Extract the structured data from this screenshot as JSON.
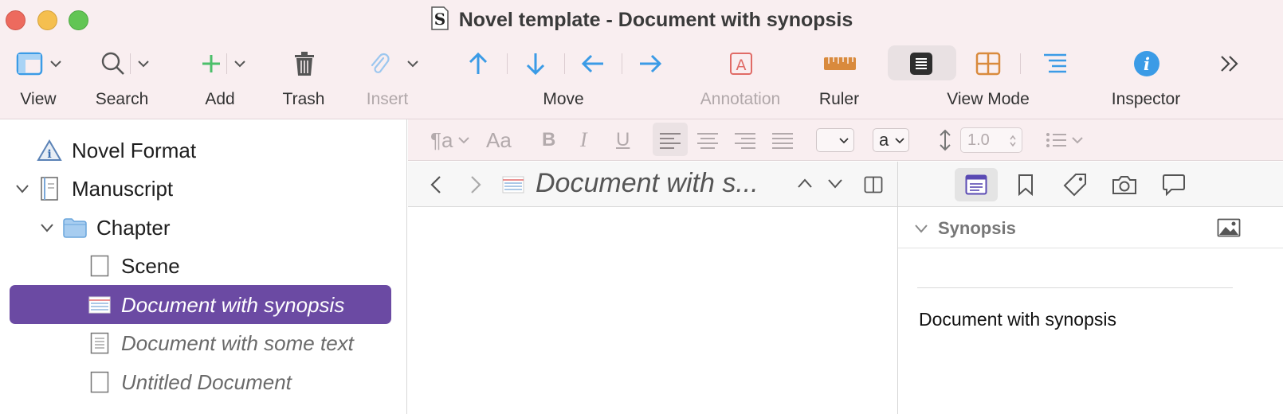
{
  "window": {
    "title": "Novel template - Document with synopsis"
  },
  "toolbar": {
    "view_label": "View",
    "search_label": "Search",
    "add_label": "Add",
    "trash_label": "Trash",
    "insert_label": "Insert",
    "move_label": "Move",
    "annotation_label": "Annotation",
    "ruler_label": "Ruler",
    "viewmode_label": "View Mode",
    "inspector_label": "Inspector"
  },
  "binder": {
    "items": [
      {
        "label": "Novel Format",
        "icon": "info-triangle-icon"
      },
      {
        "label": "Manuscript",
        "icon": "manuscript-icon"
      },
      {
        "label": "Chapter",
        "icon": "folder-icon"
      },
      {
        "label": "Scene",
        "icon": "blank-document-icon"
      },
      {
        "label": "Document with synopsis",
        "icon": "index-card-icon",
        "selected": true
      },
      {
        "label": "Document with some text",
        "icon": "text-document-icon"
      },
      {
        "label": "Untitled Document",
        "icon": "blank-document-icon"
      }
    ]
  },
  "format_bar": {
    "style_glyph": "¶a",
    "font_glyph": "Aa",
    "bold": "B",
    "italic": "I",
    "underline": "U",
    "font_size_value": "a",
    "line_spacing": "1.0"
  },
  "editor": {
    "doc_title": "Document with s..."
  },
  "inspector": {
    "section_title": "Synopsis",
    "synopsis_text": "Document with synopsis"
  },
  "colors": {
    "chrome_bg": "#f9eef0",
    "selection": "#6b4aa3",
    "accent_blue": "#3b9be6",
    "add_green": "#4cbf6a",
    "orange": "#d98a3d"
  }
}
